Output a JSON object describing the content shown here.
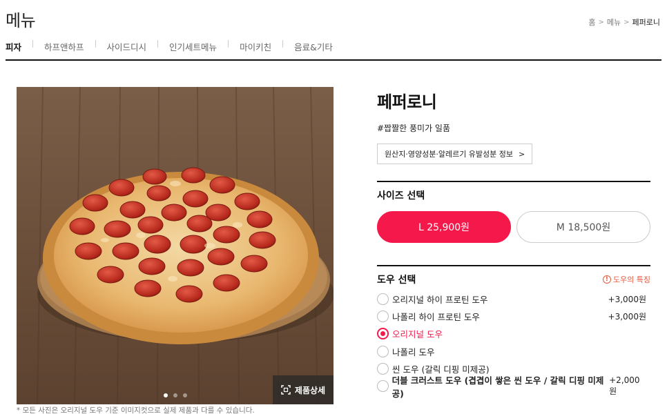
{
  "header": {
    "title": "메뉴",
    "breadcrumb": [
      "홈",
      "메뉴",
      "페퍼로니"
    ]
  },
  "tabs": [
    {
      "label": "피자",
      "active": true
    },
    {
      "label": "하프앤하프",
      "active": false
    },
    {
      "label": "사이드디시",
      "active": false
    },
    {
      "label": "인기세트메뉴",
      "active": false
    },
    {
      "label": "마이키친",
      "active": false
    },
    {
      "label": "음료&기타",
      "active": false
    }
  ],
  "image": {
    "detail_label": "제품상세",
    "note": "* 모든 사진은 오리지널 도우 기준 이미지컷으로 실제 제품과 다를 수 있습니다.",
    "slide_count": 3,
    "active_slide": 0
  },
  "product": {
    "name": "페퍼로니",
    "tag": "#짭짤한 풍미가 일품",
    "origin_button": "원산지·영양성분·알레르기 유발성분 정보"
  },
  "size": {
    "title": "사이즈 선택",
    "options": [
      {
        "label": "L 25,900원",
        "selected": true
      },
      {
        "label": "M 18,500원",
        "selected": false
      }
    ]
  },
  "dough": {
    "title": "도우 선택",
    "info_link": "도우의 특징",
    "options": [
      {
        "label": "오리지널 하이 프로틴 도우",
        "price": "+3,000원",
        "selected": false,
        "bold": false
      },
      {
        "label": "나폴리 하이 프로틴 도우",
        "price": "+3,000원",
        "selected": false,
        "bold": false
      },
      {
        "label": "오리지널 도우",
        "price": "",
        "selected": true,
        "bold": false
      },
      {
        "label": "나폴리 도우",
        "price": "",
        "selected": false,
        "bold": false
      },
      {
        "label": "씬 도우 (갈릭 디핑 미제공)",
        "price": "",
        "selected": false,
        "bold": false
      },
      {
        "label": "더블 크러스트 도우 (겹겹이 쌓은 씬 도우 / 갈릭 디핑 미제공)",
        "price": "+2,000원",
        "selected": false,
        "bold": true
      }
    ]
  },
  "colors": {
    "accent": "#f5184b",
    "info": "#e8563a"
  }
}
